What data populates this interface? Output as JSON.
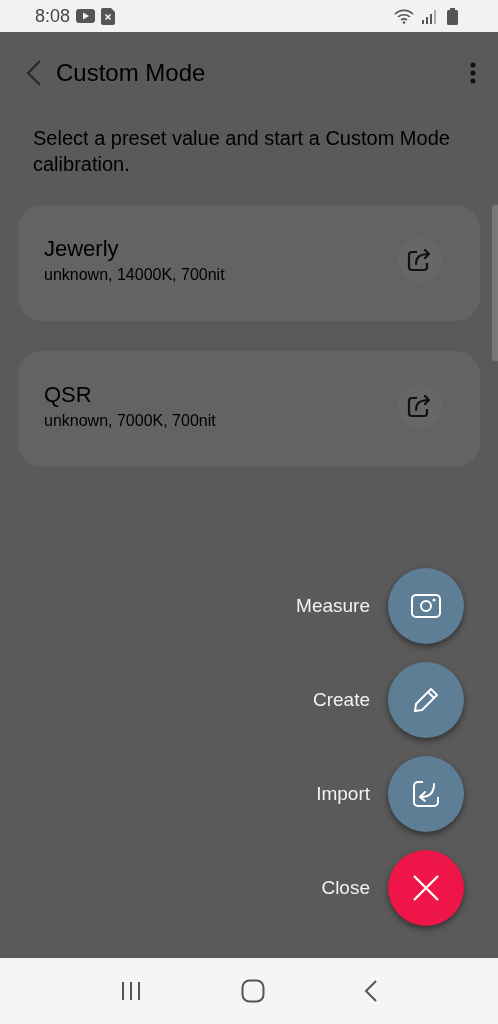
{
  "status_bar": {
    "time": "8:08"
  },
  "app_bar": {
    "title": "Custom Mode"
  },
  "description": "Select a preset value and start a Custom Mode calibration.",
  "presets": [
    {
      "name": "Jewerly",
      "details": "unknown, 14000K, 700nit"
    },
    {
      "name": "QSR",
      "details": "unknown, 7000K, 700nit"
    }
  ],
  "fab_menu": [
    {
      "label": "Measure",
      "kind": "camera"
    },
    {
      "label": "Create",
      "kind": "pencil"
    },
    {
      "label": "Import",
      "kind": "import"
    },
    {
      "label": "Close",
      "kind": "close"
    }
  ]
}
